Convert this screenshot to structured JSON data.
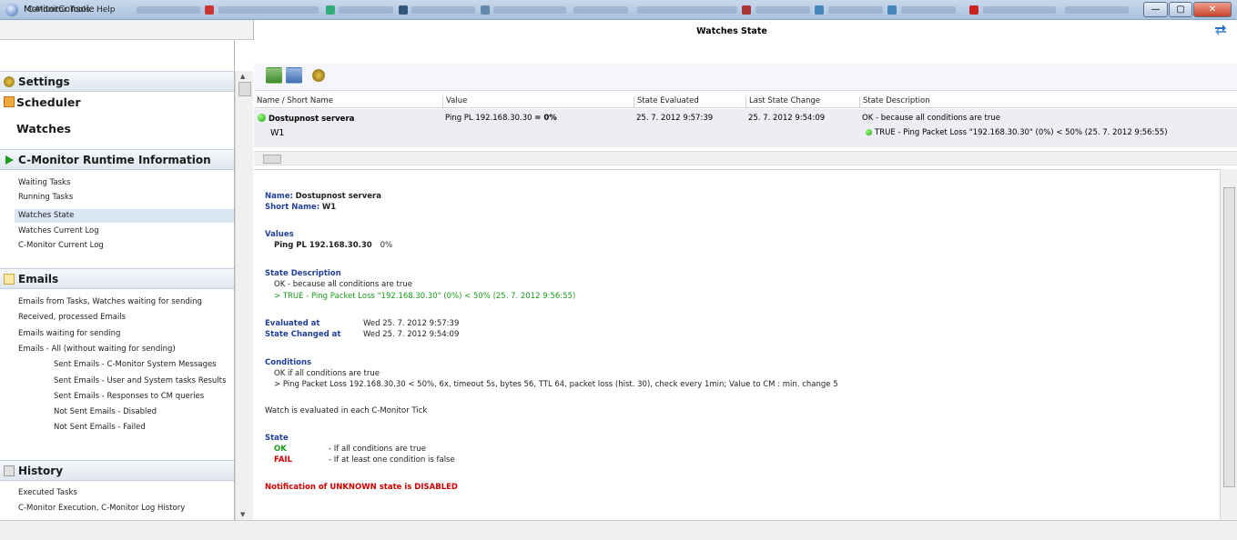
{
  "window": {
    "title": "MonitorConsole",
    "min_glyph": "—",
    "max_glyph": "▢",
    "close_glyph": "✕"
  },
  "menu": {
    "items": [
      "C-Monitor Tools",
      "Help"
    ]
  },
  "sidebar": {
    "settings_label": "Settings",
    "scheduler_label": "Scheduler",
    "watches_label": "Watches",
    "runtime_label": "C-Monitor Runtime Information",
    "runtime_items": [
      "Waiting Tasks",
      "Running Tasks",
      "Watches State",
      "Watches Current Log",
      "C-Monitor Current Log"
    ],
    "emails_label": "Emails",
    "email_items": [
      "Emails from Tasks, Watches waiting for sending",
      "Received, processed Emails",
      "Emails waiting for sending",
      "Emails - All (without waiting for sending)"
    ],
    "email_sub_items": [
      "Sent Emails - C-Monitor System Messages",
      "Sent Emails - User and System tasks Results",
      "Sent Emails - Responses to CM queries",
      "Not Sent Emails - Disabled",
      "Not Sent Emails - Failed"
    ],
    "history_label": "History",
    "history_items": [
      "Executed Tasks",
      "C-Monitor Execution, C-Monitor Log History"
    ]
  },
  "main": {
    "title": "Watches State",
    "columns": [
      "Name / Short Name",
      "Value",
      "State Evaluated",
      "Last State Change",
      "State Description"
    ],
    "row": {
      "name": "Dostupnost servera",
      "short": "W1",
      "value_text": "Ping PL 192.168.30.30",
      "value_pct": "= 0%",
      "evaluated": "25. 7. 2012 9:57:39",
      "changed": "25. 7. 2012 9:54:09",
      "desc1": "OK - because all conditions are true",
      "desc2": "TRUE - Ping Packet Loss \"192.168.30.30\" (0%) < 50% (25. 7. 2012 9:56:55)"
    },
    "detail": {
      "name_label": "Name:",
      "name_val": "Dostupnost servera",
      "short_label": "Short Name:",
      "short_val": "W1",
      "values_hdr": "Values",
      "values_line": "Ping PL 192.168.30.30",
      "values_pct": "0%",
      "statedesc_hdr": "State Description",
      "statedesc_1": "OK - because all conditions are true",
      "statedesc_2": "> TRUE - Ping Packet Loss \"192.168.30.30\" (0%) < 50% (25. 7. 2012 9:56:55)",
      "evaluated_label": "Evaluated at",
      "evaluated_val": "Wed 25. 7. 2012 9:57:39",
      "changed_label": "State Changed at",
      "changed_val": "Wed 25. 7. 2012 9:54:09",
      "conditions_hdr": "Conditions",
      "conditions_1": "OK if all conditions are true",
      "conditions_2": "> Ping Packet Loss 192.168.30.30 < 50%, 6x, timeout 5s, bytes 56, TTL 64, packet loss (hist. 30), check every 1min; Value to CM : min. change 5",
      "tick_note": "Watch is evaluated in each C-Monitor Tick",
      "state_hdr": "State",
      "state_ok": "OK",
      "state_ok_desc": "- If all conditions are true",
      "state_fail": "FAIL",
      "state_fail_desc": "- If at least one condition is false",
      "notification": "Notification of UNKNOWN state is DISABLED"
    }
  },
  "colors": {
    "ok": "#1a9a1a",
    "fail": "#d10000",
    "header_blue": "#1f3f9a"
  }
}
